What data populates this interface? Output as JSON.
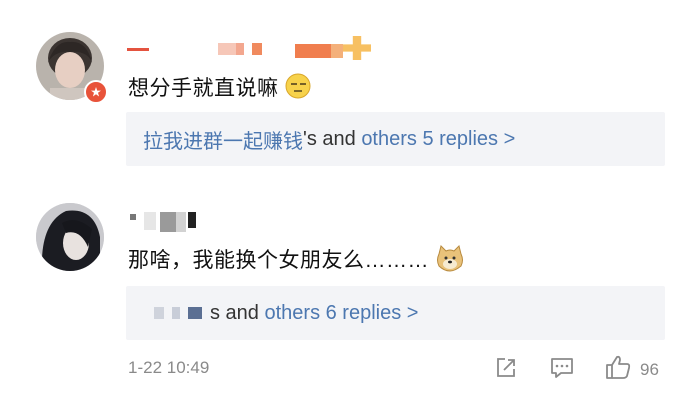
{
  "comments": [
    {
      "text": "想分手就直说嘛",
      "emoji": "sleepy-face-emoji",
      "reply_box": {
        "user": "拉我进群一起赚钱",
        "middle": "'s and ",
        "link": "others 5 replies >"
      }
    },
    {
      "text": "那啥，我能换个女朋友么………",
      "emoji": "doge-emoji",
      "reply_box": {
        "middle": "s and ",
        "link": "others 6 replies >"
      }
    }
  ],
  "footer": {
    "timestamp": "1-22 10:49",
    "like_count": "96",
    "icons": [
      "share-icon",
      "comment-icon",
      "like-icon"
    ]
  },
  "colors": {
    "link": "#4c77b0",
    "reply_bg": "#f3f4f7",
    "badge": "#e8533a"
  }
}
